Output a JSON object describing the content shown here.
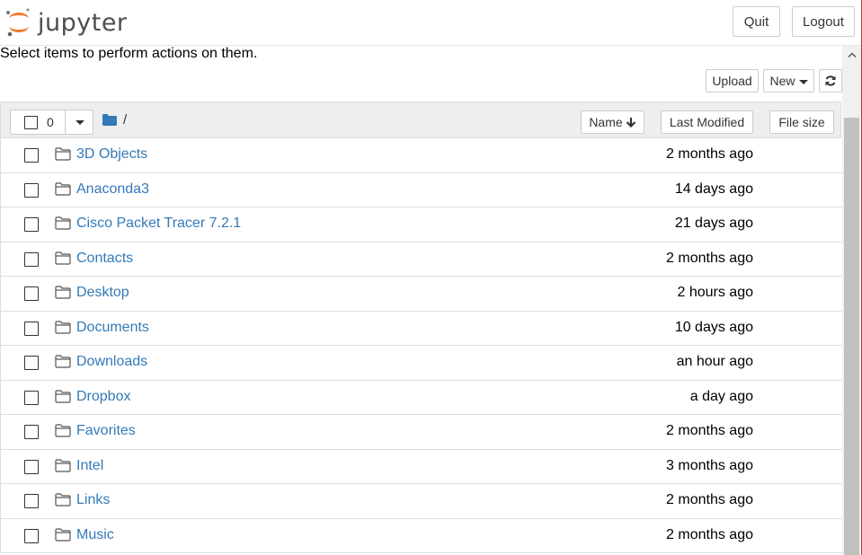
{
  "header": {
    "logo_text": "jupyter",
    "quit_label": "Quit",
    "logout_label": "Logout"
  },
  "intro_text": "Select items to perform actions on them.",
  "toolbar": {
    "upload_label": "Upload",
    "new_label": "New"
  },
  "list_header": {
    "selected_count": "0",
    "breadcrumb_sep": "/",
    "col_name": "Name",
    "col_modified": "Last Modified",
    "col_size": "File size"
  },
  "items": [
    {
      "name": "3D Objects",
      "modified": "2 months ago"
    },
    {
      "name": "Anaconda3",
      "modified": "14 days ago"
    },
    {
      "name": "Cisco Packet Tracer 7.2.1",
      "modified": "21 days ago"
    },
    {
      "name": "Contacts",
      "modified": "2 months ago"
    },
    {
      "name": "Desktop",
      "modified": "2 hours ago"
    },
    {
      "name": "Documents",
      "modified": "10 days ago"
    },
    {
      "name": "Downloads",
      "modified": "an hour ago"
    },
    {
      "name": "Dropbox",
      "modified": "a day ago"
    },
    {
      "name": "Favorites",
      "modified": "2 months ago"
    },
    {
      "name": "Intel",
      "modified": "3 months ago"
    },
    {
      "name": "Links",
      "modified": "2 months ago"
    },
    {
      "name": "Music",
      "modified": "2 months ago"
    }
  ],
  "colors": {
    "link": "#337ab7",
    "logo_orange": "#f37726",
    "header_bg": "#eeeeee"
  }
}
